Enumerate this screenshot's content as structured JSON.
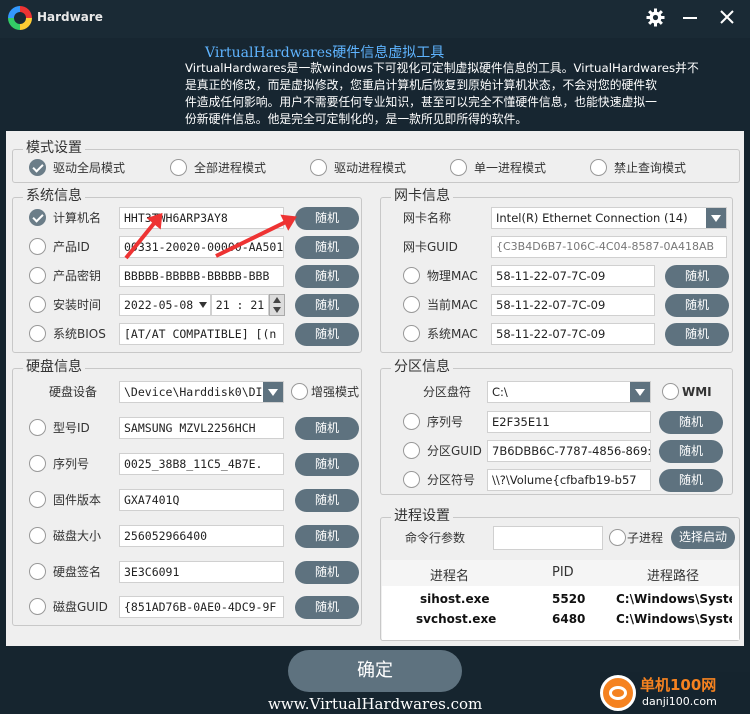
{
  "title": "Hardware",
  "banner": {
    "heading": "VirtualHardwares硬件信息虚拟工具",
    "lines": [
      "VirtualHardwares是一款windows下可视化可定制虚拟硬件信息的工具。VirtualHardwares并不",
      "是真正的修改，而是虚拟修改，您重启计算机后恢复到原始计算机状态，不会对您的硬件软",
      "件造成任何影响。用户不需要任何专业知识，甚至可以完全不懂硬件信息，也能快速虚拟一",
      "份新硬件信息。他是完全可定制化的，是一款所见即所得的软件。"
    ]
  },
  "mode": {
    "title": "模式设置",
    "options": [
      "驱动全局模式",
      "全部进程模式",
      "驱动进程模式",
      "单一进程模式",
      "禁止查询模式"
    ]
  },
  "sys": {
    "title": "系统信息",
    "labels": [
      "计算机名",
      "产品ID",
      "产品密钥",
      "安装时间",
      "系统BIOS"
    ],
    "values": [
      "HHT3TWH6ARP3AY8",
      "00331-20020-00000-AA501",
      "BBBBB-BBBBB-BBBBB-BBB",
      "2022-05-08",
      "[AT/AT COMPATIBLE] [(n"
    ],
    "time": "21 : 21"
  },
  "btn": "随机",
  "net": {
    "title": "网卡信息",
    "name_label": "网卡名称",
    "name_value": "Intel(R) Ethernet Connection (14)",
    "guid_label": "网卡GUID",
    "guid_value": "{C3B4D6B7-106C-4C04-8587-0A418AB",
    "labels": [
      "物理MAC",
      "当前MAC",
      "系统MAC"
    ],
    "values": [
      "58-11-22-07-7C-09",
      "58-11-22-07-7C-09",
      "58-11-22-07-7C-09"
    ]
  },
  "disk": {
    "title": "硬盘信息",
    "device_label": "硬盘设备",
    "device_value": "\\Device\\Harddisk0\\DI",
    "enhance": "增强模式",
    "labels": [
      "型号ID",
      "序列号",
      "固件版本",
      "磁盘大小",
      "硬盘签名",
      "磁盘GUID"
    ],
    "values": [
      "SAMSUNG MZVL2256HCH",
      "0025_38B8_11C5_4B7E.",
      "GXA7401Q",
      "256052966400",
      "3E3C6091",
      "{851AD76B-0AE0-4DC9-9F"
    ]
  },
  "part": {
    "title": "分区信息",
    "drive_label": "分区盘符",
    "drive_value": "C:\\",
    "wmi": "WMI",
    "labels": [
      "序列号",
      "分区GUID",
      "分区符号"
    ],
    "values": [
      "E2F35E11",
      "7B6DBB6C-7787-4856-869:",
      "\\\\?\\Volume{cfbafb19-b57"
    ]
  },
  "proc": {
    "title": "进程设置",
    "cmd_label": "命令行参数",
    "child": "子进程",
    "start": "选择启动",
    "headers": [
      "进程名",
      "PID",
      "进程路径"
    ],
    "rows": [
      {
        "name": "sihost.exe",
        "pid": "5520",
        "path": "C:\\Windows\\Syster"
      },
      {
        "name": "svchost.exe",
        "pid": "6480",
        "path": "C:\\Windows\\Syster"
      }
    ]
  },
  "ok": "确定",
  "url": "www.VirtualHardwares.com",
  "watermark": {
    "name": "单机100网",
    "domain": "danji100.com"
  },
  "colors": {
    "accent": "#5e727f",
    "banner_heading": "#5fb4ff",
    "arrow": "#e33333"
  }
}
